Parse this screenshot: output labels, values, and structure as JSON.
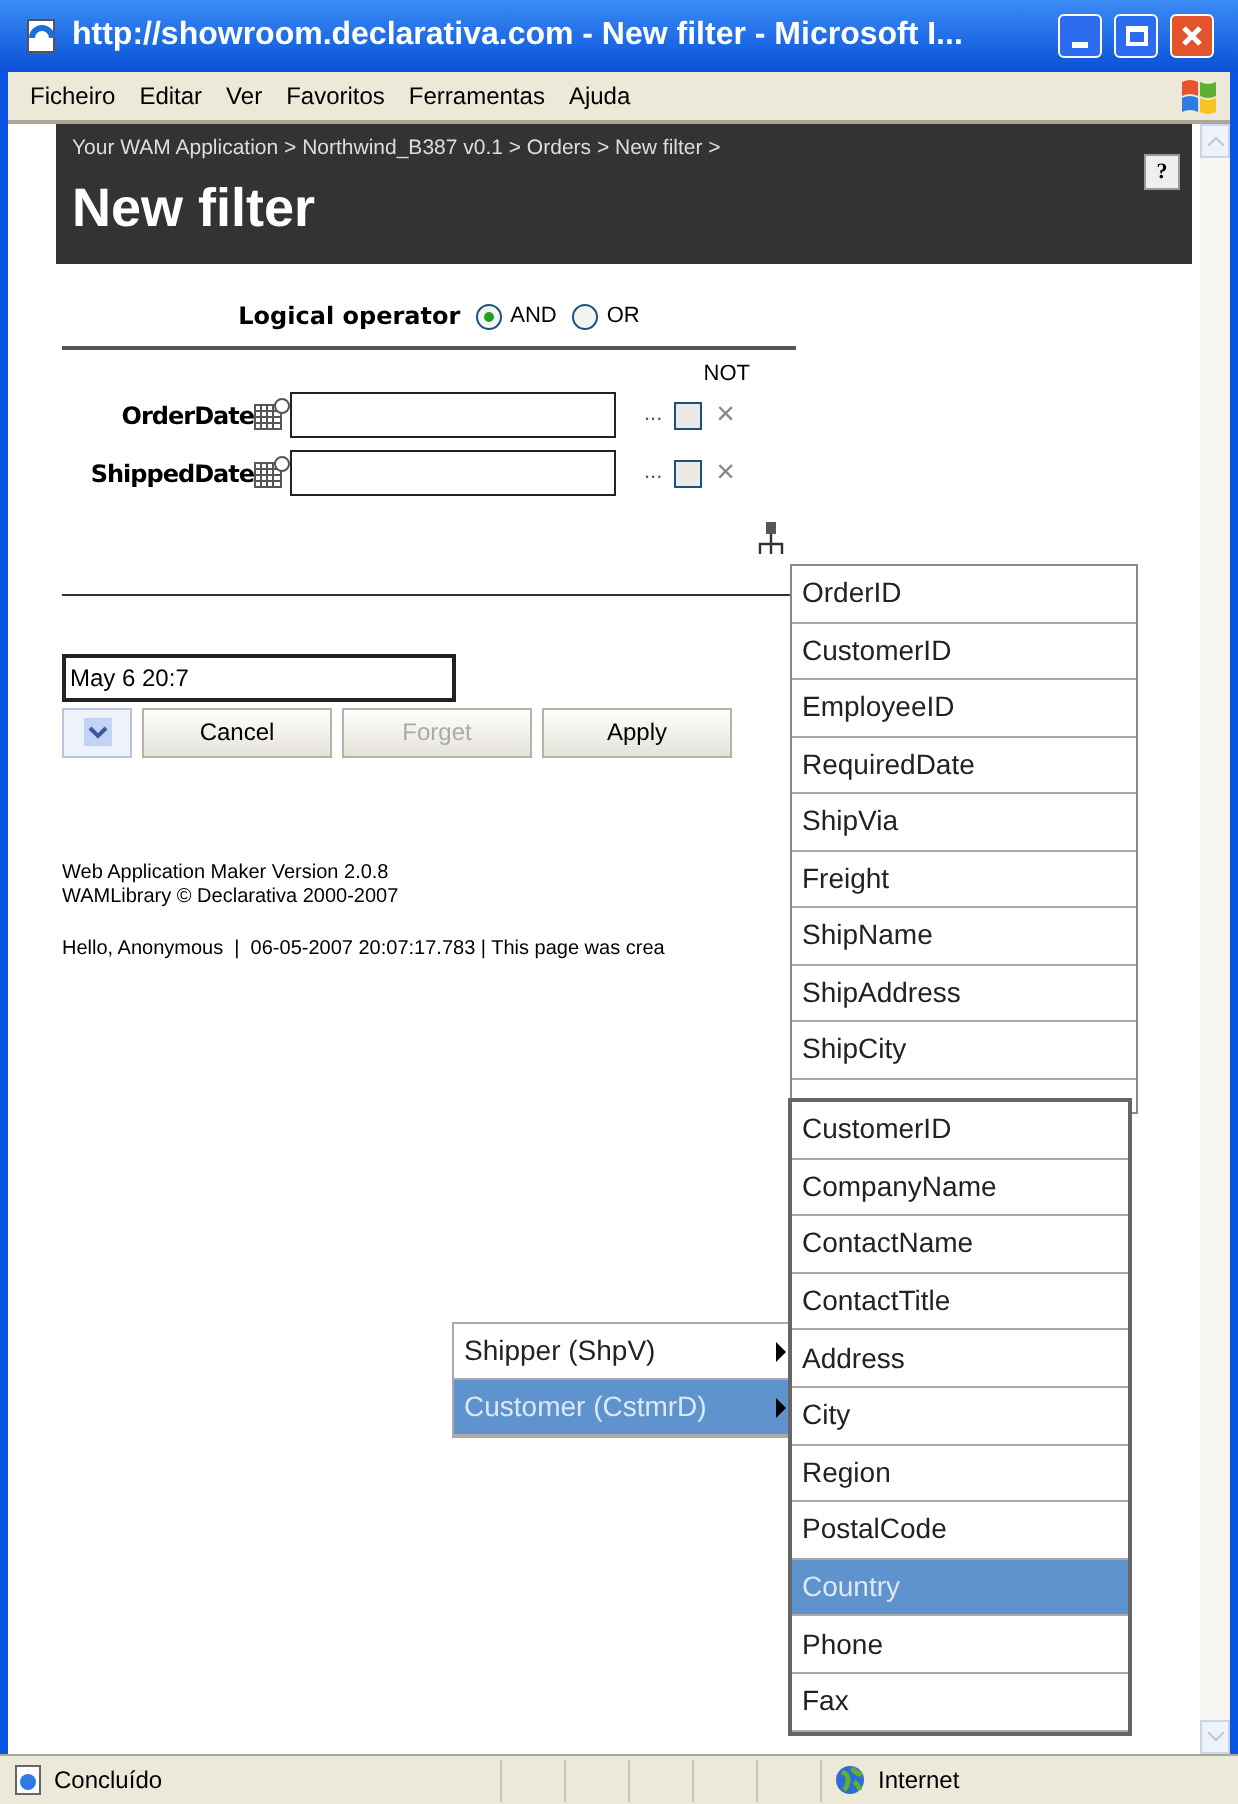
{
  "window": {
    "title": "http://showroom.declarativa.com - New filter - Microsoft I..."
  },
  "menu_bar": [
    "Ficheiro",
    "Editar",
    "Ver",
    "Favoritos",
    "Ferramentas",
    "Ajuda"
  ],
  "header": {
    "breadcrumb": "Your WAM Application > Northwind_B387 v0.1 > Orders > New filter >",
    "title": "New filter"
  },
  "logical_operator": {
    "label": "Logical operator",
    "options": [
      {
        "label": "AND",
        "selected": true
      },
      {
        "label": "OR",
        "selected": false
      }
    ]
  },
  "not_header": "NOT",
  "fields": [
    {
      "label": "OrderDate",
      "more": "...",
      "checked": false,
      "remove": "×"
    },
    {
      "label": "ShippedDate",
      "more": "...",
      "checked": false,
      "remove": "×"
    }
  ],
  "help": "?",
  "date_field": {
    "value": "May 6 20:7"
  },
  "buttons": [
    {
      "label": "Cancel",
      "disabled": false
    },
    {
      "label": "Forget",
      "disabled": true
    },
    {
      "label": "Apply",
      "disabled": false
    }
  ],
  "footer": {
    "lines": [
      "Web Application Maker Version 2.0.8",
      "WAMLibrary © Declarativa 2000-2007"
    ],
    "status": "Hello, Anonymous  |  06-05-2007 20:07:17.783 | This page was crea"
  },
  "field_menu": [
    {
      "label": "OrderID",
      "selected": false
    },
    {
      "label": "CustomerID",
      "selected": false
    },
    {
      "label": "EmployeeID",
      "selected": false
    },
    {
      "label": "RequiredDate",
      "selected": false
    },
    {
      "label": "ShipVia",
      "selected": false
    },
    {
      "label": "Freight",
      "selected": false
    },
    {
      "label": "ShipName",
      "selected": false
    },
    {
      "label": "ShipAddress",
      "selected": false
    },
    {
      "label": "ShipCity",
      "selected": false
    }
  ],
  "relation_menu": [
    {
      "label": "Shipper (ShpV)",
      "selected": false
    },
    {
      "label": "Customer (CstmrD)",
      "selected": true
    }
  ],
  "customer_menu": [
    {
      "label": "CustomerID",
      "selected": false
    },
    {
      "label": "CompanyName",
      "selected": false
    },
    {
      "label": "ContactName",
      "selected": false
    },
    {
      "label": "ContactTitle",
      "selected": false
    },
    {
      "label": "Address",
      "selected": false
    },
    {
      "label": "City",
      "selected": false
    },
    {
      "label": "Region",
      "selected": false
    },
    {
      "label": "PostalCode",
      "selected": false
    },
    {
      "label": "Country",
      "selected": true
    },
    {
      "label": "Phone",
      "selected": false
    },
    {
      "label": "Fax",
      "selected": false
    }
  ],
  "status_bar": {
    "text": "Concluído",
    "zone": "Internet"
  }
}
